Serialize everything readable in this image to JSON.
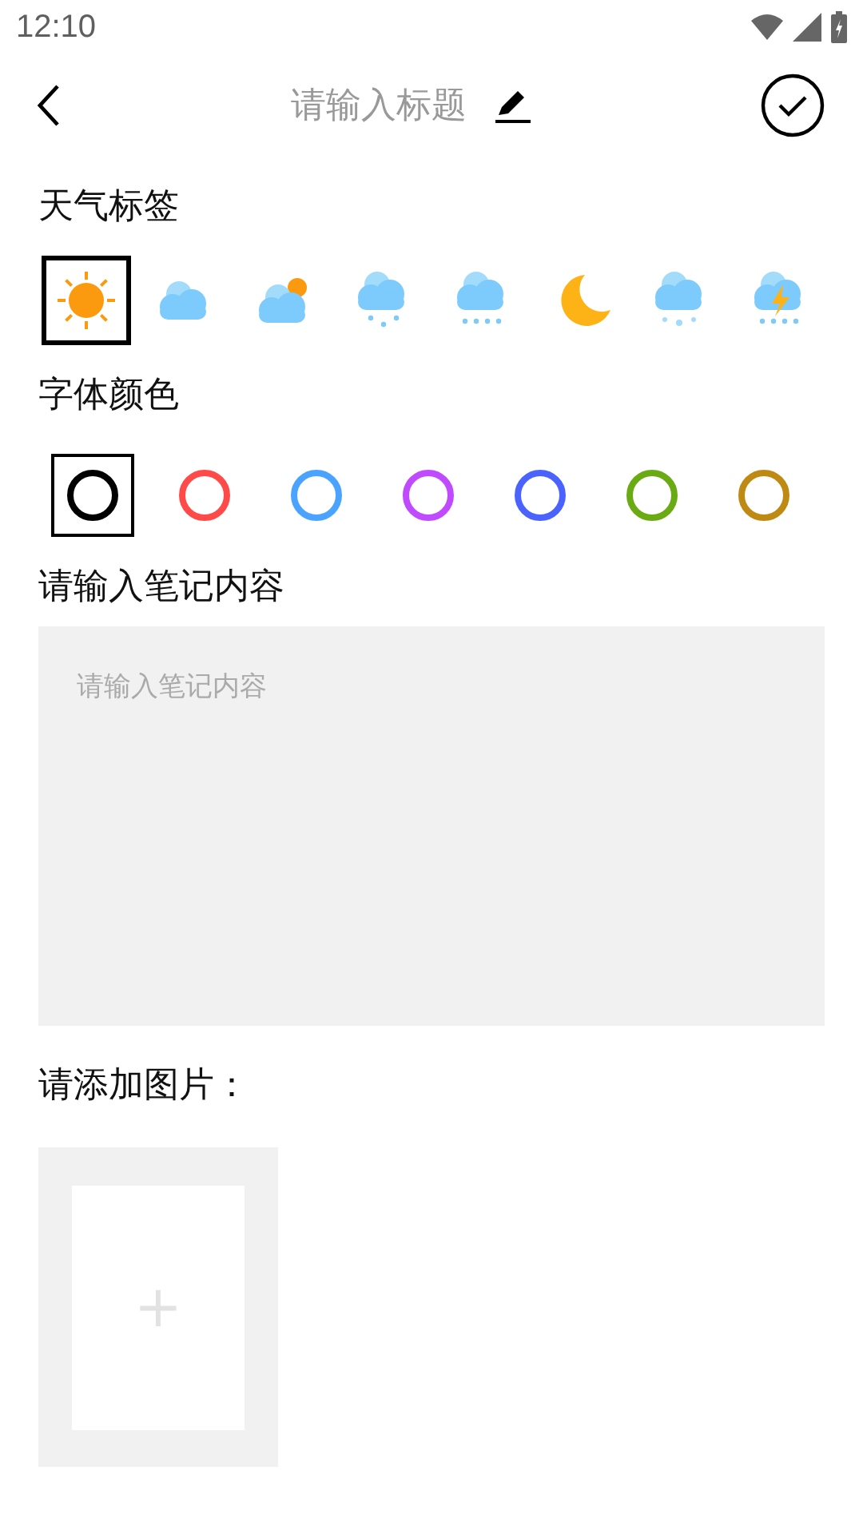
{
  "status_bar": {
    "time": "12:10"
  },
  "header": {
    "title_placeholder": "请输入标题"
  },
  "weather": {
    "label": "天气标签",
    "items": [
      {
        "kind": "sun",
        "selected": true
      },
      {
        "kind": "cloud",
        "selected": false
      },
      {
        "kind": "partly",
        "selected": false
      },
      {
        "kind": "shower",
        "selected": false
      },
      {
        "kind": "rain",
        "selected": false
      },
      {
        "kind": "moon",
        "selected": false
      },
      {
        "kind": "snow",
        "selected": false
      },
      {
        "kind": "thunder",
        "selected": false
      }
    ]
  },
  "font_color": {
    "label": "字体颜色",
    "items": [
      {
        "color": "#000000",
        "selected": true
      },
      {
        "color": "#ff4a4a",
        "selected": false
      },
      {
        "color": "#4aa3ff",
        "selected": false
      },
      {
        "color": "#c04aff",
        "selected": false
      },
      {
        "color": "#4a63ff",
        "selected": false
      },
      {
        "color": "#6aab14",
        "selected": false
      },
      {
        "color": "#be8a14",
        "selected": false
      }
    ]
  },
  "content": {
    "label": "请输入笔记内容",
    "placeholder": "请输入笔记内容"
  },
  "images": {
    "label": "请添加图片：",
    "add": "+"
  }
}
